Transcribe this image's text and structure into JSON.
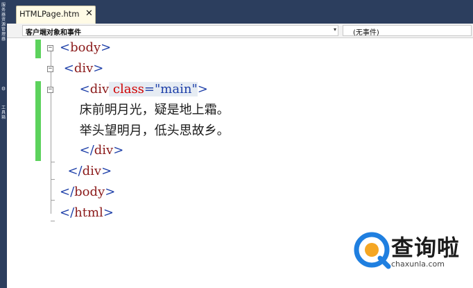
{
  "sidebar": {
    "vertical_text_top": "服务器资源管理器",
    "vertical_text_bottom": "工具箱",
    "icon": "toolbox-icon"
  },
  "tab": {
    "title": "HTMLPage.htm",
    "close_glyph": "✕"
  },
  "navbar": {
    "left_label": "客户端对象和事件",
    "left_arrow": "▾",
    "right_label": "(无事件)"
  },
  "code_lines": [
    {
      "pre": "",
      "open": "<",
      "tag": "body",
      "attr": "",
      "eq": "",
      "val": "",
      "close": ">",
      "text": ""
    },
    {
      "pre": " ",
      "open": "<",
      "tag": "div",
      "attr": "",
      "eq": "",
      "val": "",
      "close": ">",
      "text": ""
    },
    {
      "pre": "     ",
      "open": "<",
      "tag": "div",
      "attr": " class",
      "eq": "=",
      "val": "\"main\"",
      "close": ">",
      "text": ""
    },
    {
      "pre": "     ",
      "open": "",
      "tag": "",
      "attr": "",
      "eq": "",
      "val": "",
      "close": "",
      "text": "床前明月光，疑是地上霜。"
    },
    {
      "pre": "     ",
      "open": "",
      "tag": "",
      "attr": "",
      "eq": "",
      "val": "",
      "close": "",
      "text": "举头望明月，低头思故乡。"
    },
    {
      "pre": "     ",
      "open": "</",
      "tag": "div",
      "attr": "",
      "eq": "",
      "val": "",
      "close": ">",
      "text": ""
    },
    {
      "pre": "  ",
      "open": "</",
      "tag": "div",
      "attr": "",
      "eq": "",
      "val": "",
      "close": ">",
      "text": ""
    },
    {
      "pre": "",
      "open": "</",
      "tag": "body",
      "attr": "",
      "eq": "",
      "val": "",
      "close": ">",
      "text": ""
    },
    {
      "pre": "",
      "open": "</",
      "tag": "html",
      "attr": "",
      "eq": "",
      "val": "",
      "close": ">",
      "text": ""
    }
  ],
  "fold_glyph": "−",
  "watermark": {
    "brand": "查询啦",
    "url": "chaxunla.com",
    "colors": {
      "blue": "#1f7fe0",
      "orange": "#f5a623"
    }
  },
  "colors": {
    "titlebar": "#2c3e5e",
    "tab_bg": "#fffbe6",
    "change_bar": "#5cd25c",
    "tag": "#8b1a1a",
    "bracket": "#1c3ea8",
    "attr": "#d10000"
  }
}
